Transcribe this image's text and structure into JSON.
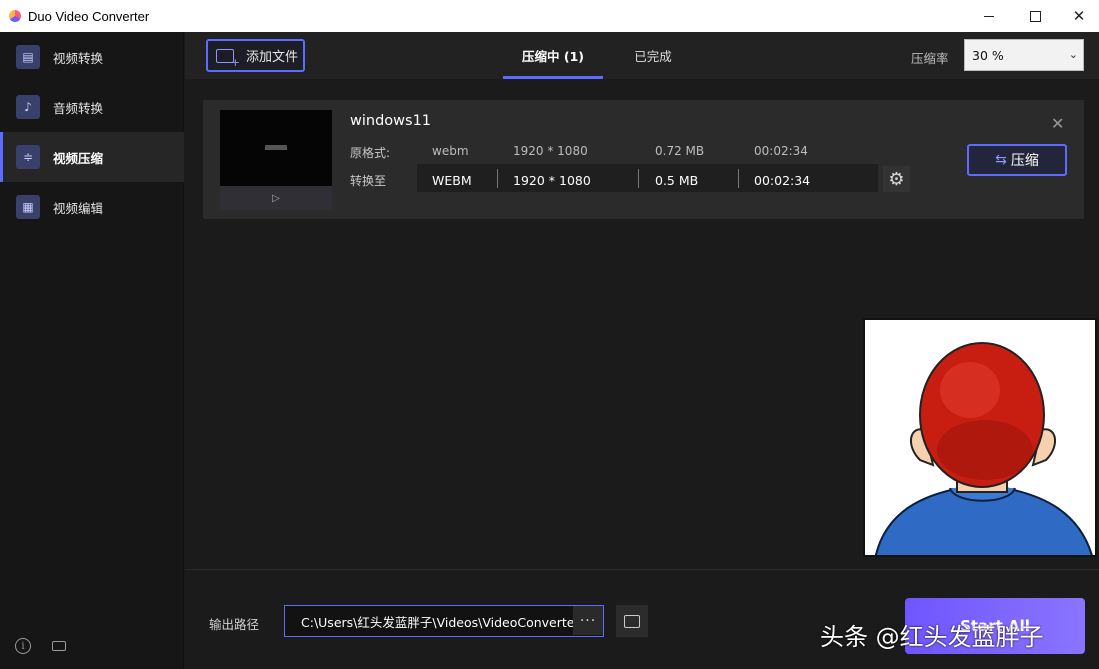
{
  "window": {
    "title": "Duo Video Converter"
  },
  "sidebar": {
    "items": [
      {
        "label": "视频转换",
        "icon": "video-convert-icon"
      },
      {
        "label": "音频转换",
        "icon": "audio-convert-icon"
      },
      {
        "label": "视频压缩",
        "icon": "video-compress-icon",
        "active": true
      },
      {
        "label": "视频编辑",
        "icon": "video-edit-icon"
      }
    ]
  },
  "toolbar": {
    "add_file_label": "添加文件",
    "tabs": [
      {
        "label": "压缩中 (1)",
        "active": true
      },
      {
        "label": "已完成",
        "active": false
      }
    ],
    "rate_label": "压缩率",
    "rate_value": "30 %"
  },
  "file": {
    "name": "windows11",
    "original_label": "原格式:",
    "original": {
      "format": "webm",
      "resolution": "1920 * 1080",
      "size": "0.72 MB",
      "duration": "00:02:34"
    },
    "convert_label": "转换至",
    "target": {
      "format": "WEBM",
      "resolution": "1920 * 1080",
      "size": "0.5 MB",
      "duration": "00:02:34"
    },
    "compress_button": "压缩"
  },
  "footer": {
    "output_label": "输出路径",
    "output_path": "C:\\Users\\红头发蓝胖子\\Videos\\VideoConverter",
    "path_dots": "···",
    "start_all": "Start All"
  },
  "watermark": "头条 @红头发蓝胖子",
  "colors": {
    "accent": "#5b6cff",
    "background": "#1b1b1b",
    "card": "#2b2b2b"
  }
}
